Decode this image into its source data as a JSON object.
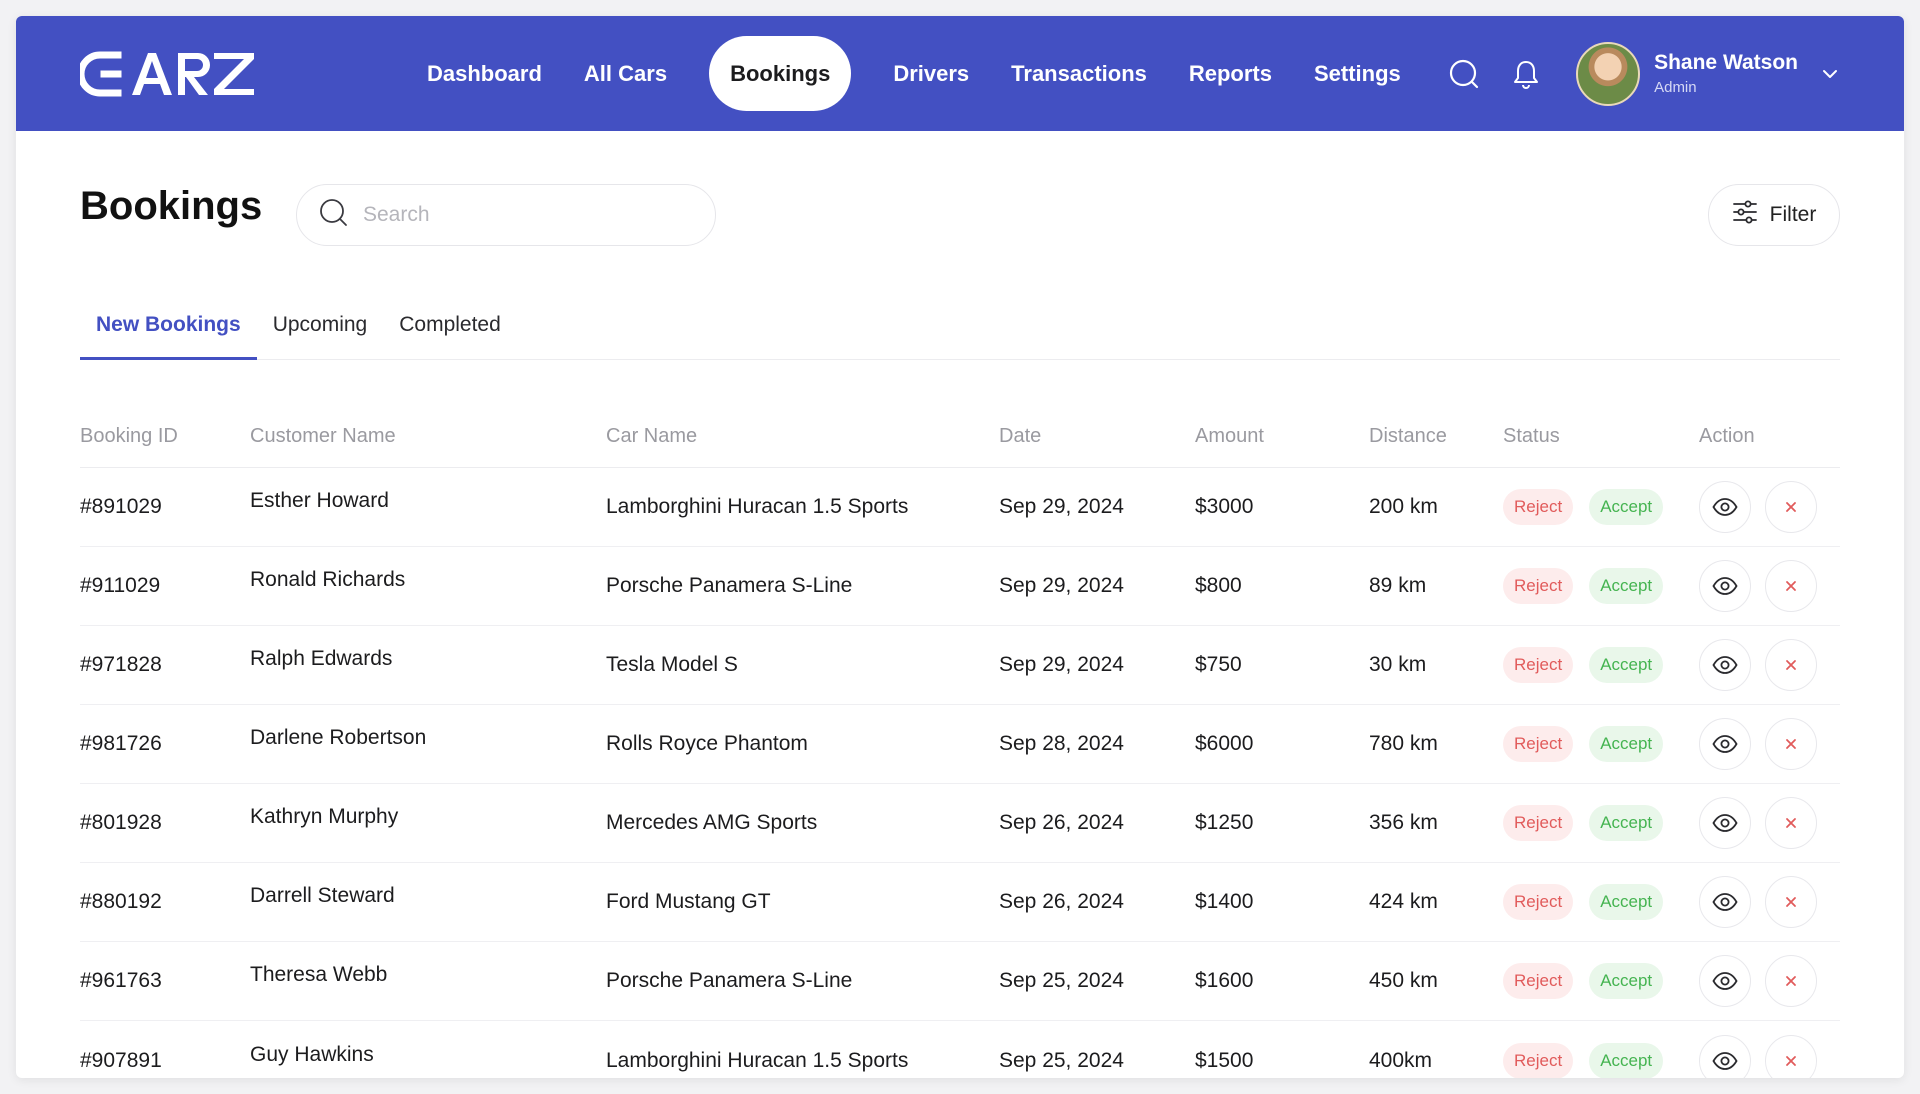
{
  "brand": {
    "logo_text": "CARZ",
    "accent": "#4350c2"
  },
  "nav": {
    "items": [
      {
        "label": "Dashboard",
        "active": false
      },
      {
        "label": "All Cars",
        "active": false
      },
      {
        "label": "Bookings",
        "active": true
      },
      {
        "label": "Drivers",
        "active": false
      },
      {
        "label": "Transactions",
        "active": false
      },
      {
        "label": "Reports",
        "active": false
      },
      {
        "label": "Settings",
        "active": false
      }
    ]
  },
  "user": {
    "name": "Shane Watson",
    "role": "Admin"
  },
  "page": {
    "title": "Bookings"
  },
  "search": {
    "placeholder": "Search",
    "value": ""
  },
  "filter": {
    "label": "Filter"
  },
  "tabs": [
    {
      "label": "New Bookings",
      "active": true
    },
    {
      "label": "Upcoming",
      "active": false
    },
    {
      "label": "Completed",
      "active": false
    }
  ],
  "table": {
    "columns": [
      "Booking ID",
      "Customer Name",
      "Car Name",
      "Date",
      "Amount",
      "Distance",
      "Status",
      "Action"
    ],
    "status_labels": {
      "reject": "Reject",
      "accept": "Accept"
    },
    "rows": [
      {
        "id": "#891029",
        "customer": "Esther Howard",
        "car": "Lamborghini Huracan 1.5 Sports",
        "date": "Sep 29, 2024",
        "amount": "$3000",
        "distance": "200 km"
      },
      {
        "id": "#911029",
        "customer": "Ronald Richards",
        "car": "Porsche Panamera S-Line",
        "date": "Sep 29, 2024",
        "amount": "$800",
        "distance": "89 km"
      },
      {
        "id": "#971828",
        "customer": "Ralph Edwards",
        "car": "Tesla Model S",
        "date": "Sep 29, 2024",
        "amount": "$750",
        "distance": "30 km"
      },
      {
        "id": "#981726",
        "customer": "Darlene Robertson",
        "car": "Rolls Royce Phantom",
        "date": "Sep 28, 2024",
        "amount": "$6000",
        "distance": "780 km"
      },
      {
        "id": "#801928",
        "customer": "Kathryn Murphy",
        "car": "Mercedes AMG Sports",
        "date": "Sep 26, 2024",
        "amount": "$1250",
        "distance": "356 km"
      },
      {
        "id": "#880192",
        "customer": "Darrell Steward",
        "car": "Ford Mustang GT",
        "date": "Sep 26, 2024",
        "amount": "$1400",
        "distance": "424 km"
      },
      {
        "id": "#961763",
        "customer": "Theresa Webb",
        "car": "Porsche Panamera S-Line",
        "date": "Sep 25, 2024",
        "amount": "$1600",
        "distance": "450 km"
      },
      {
        "id": "#907891",
        "customer": "Guy Hawkins",
        "car": "Lamborghini Huracan 1.5 Sports",
        "date": "Sep 25, 2024",
        "amount": "$1500",
        "distance": "400km"
      }
    ]
  },
  "icons": {
    "search": "search-icon",
    "bell": "bell-icon",
    "chevron": "chevron-down-icon",
    "filter": "sliders-icon",
    "view": "eye-icon",
    "close": "close-icon"
  }
}
